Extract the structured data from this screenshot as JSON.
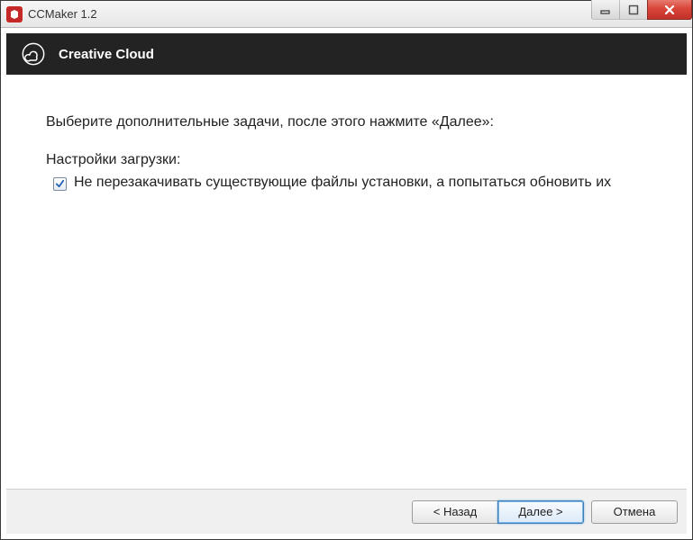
{
  "window": {
    "title": "CCMaker 1.2"
  },
  "header": {
    "brand": "Creative Cloud"
  },
  "content": {
    "instruction": "Выберите дополнительные задачи, после этого нажмите «Далее»:",
    "section_label": "Настройки загрузки:",
    "option1": {
      "checked": true,
      "label": "Не перезакачивать существующие файлы установки, а попытаться обновить их"
    }
  },
  "footer": {
    "back": "< Назад",
    "next": "Далее >",
    "cancel": "Отмена"
  }
}
